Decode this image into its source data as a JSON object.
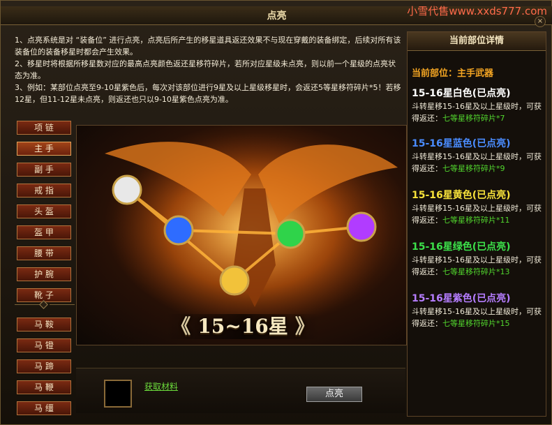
{
  "window": {
    "title": "点亮",
    "close_label": "×"
  },
  "watermark": "小雪代售www.xxds777.com",
  "instructions": [
    "1、点亮系统是对 “装备位” 进行点亮，点亮后所产生的移星道具返还效果不与现在穿戴的装备绑定，后续对所有该装备位的装备移星时都会产生效果。",
    "2、移星时将根据所移星数对应的最高点亮颜色返还星移符碎片，若所对应星级未点亮，则以前一个星级的点亮状态为准。",
    "3、例如：某部位点亮至9-10星紫色后，每次对该部位进行9星及以上星级移星时，会返还5等星移符碎片*5！若移12星，但11-12星未点亮，则返还也只以9-10星紫色点亮为准。"
  ],
  "slots": [
    {
      "label": "项 链",
      "active": false
    },
    {
      "label": "主 手",
      "active": true
    },
    {
      "label": "副 手",
      "active": false
    },
    {
      "label": "戒 指",
      "active": false
    },
    {
      "label": "头 盔",
      "active": false
    },
    {
      "label": "盔 甲",
      "active": false
    },
    {
      "label": "腰 带",
      "active": false
    },
    {
      "label": "护 腕",
      "active": false
    },
    {
      "label": "靴 子",
      "active": false
    },
    {
      "label": "马 鞍",
      "active": false
    },
    {
      "label": "马 镫",
      "active": false
    },
    {
      "label": "马 蹄",
      "active": false
    },
    {
      "label": "马 鞭",
      "active": false
    },
    {
      "label": "马 缰",
      "active": false
    }
  ],
  "stage": {
    "star_range": "15~16星",
    "arrow_left": "《",
    "arrow_right": "》",
    "orbs": [
      {
        "name": "white-orb",
        "color": "#e8e8e8"
      },
      {
        "name": "blue-orb",
        "color": "#2e6cff"
      },
      {
        "name": "gold-orb",
        "color": "#f2c23a"
      },
      {
        "name": "green-orb",
        "color": "#2fd34a"
      },
      {
        "name": "purple-orb",
        "color": "#b13cff"
      }
    ]
  },
  "material": {
    "link_label": "获取材料"
  },
  "action": {
    "lightup_label": "点亮"
  },
  "detail": {
    "header": "当前部位详情",
    "current_slot": "当前部位：主手武器",
    "tiers": [
      {
        "title": "15-16星白色(已点亮)",
        "color": "#ffffff",
        "desc": "斗转星移15-16星及以上星级时，可获",
        "reward_prefix": "得返还：",
        "reward": "七等星移符碎片*7"
      },
      {
        "title": "15-16星蓝色(已点亮)",
        "color": "#4a8cff",
        "desc": "斗转星移15-16星及以上星级时，可获",
        "reward_prefix": "得返还：",
        "reward": "七等星移符碎片*9"
      },
      {
        "title": "15-16星黄色(已点亮)",
        "color": "#f7e23a",
        "desc": "斗转星移15-16星及以上星级时，可获",
        "reward_prefix": "得返还：",
        "reward": "七等星移符碎片*11"
      },
      {
        "title": "15-16星绿色(已点亮)",
        "color": "#3ce04a",
        "desc": "斗转星移15-16星及以上星级时，可获",
        "reward_prefix": "得返还：",
        "reward": "七等星移符碎片*13"
      },
      {
        "title": "15-16星紫色(已点亮)",
        "color": "#b57dff",
        "desc": "斗转星移15-16星及以上星级时，可获",
        "reward_prefix": "得返还：",
        "reward": "七等星移符碎片*15"
      }
    ]
  }
}
